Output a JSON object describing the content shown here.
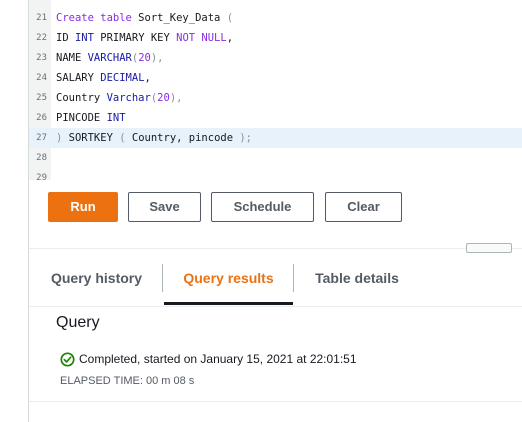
{
  "editor": {
    "lines": [
      {
        "num": "21",
        "tokens": [
          {
            "t": "Create table",
            "c": "kw"
          },
          {
            "t": " Sort_Key_Data ",
            "c": ""
          },
          {
            "t": "(",
            "c": "punct"
          }
        ]
      },
      {
        "num": "22",
        "tokens": [
          {
            "t": "ID ",
            "c": ""
          },
          {
            "t": "INT",
            "c": "kw2"
          },
          {
            "t": " PRIMARY KEY ",
            "c": ""
          },
          {
            "t": "NOT NULL",
            "c": "kw"
          },
          {
            "t": ",",
            "c": ""
          }
        ]
      },
      {
        "num": "23",
        "tokens": [
          {
            "t": "NAME ",
            "c": ""
          },
          {
            "t": "VARCHAR",
            "c": "kw2"
          },
          {
            "t": "(",
            "c": "punct"
          },
          {
            "t": "20",
            "c": "num"
          },
          {
            "t": "),",
            "c": "punct"
          }
        ]
      },
      {
        "num": "24",
        "tokens": [
          {
            "t": "SALARY ",
            "c": ""
          },
          {
            "t": "DECIMAL",
            "c": "kw2"
          },
          {
            "t": ",",
            "c": ""
          }
        ]
      },
      {
        "num": "25",
        "tokens": [
          {
            "t": "Country ",
            "c": ""
          },
          {
            "t": "Varchar",
            "c": "kw2"
          },
          {
            "t": "(",
            "c": "punct"
          },
          {
            "t": "20",
            "c": "num"
          },
          {
            "t": "),",
            "c": "punct"
          }
        ]
      },
      {
        "num": "26",
        "tokens": [
          {
            "t": "PINCODE ",
            "c": ""
          },
          {
            "t": "INT",
            "c": "kw2"
          }
        ]
      },
      {
        "num": "27",
        "active": true,
        "tokens": [
          {
            "t": ")",
            "c": "punct"
          },
          {
            "t": " SORTKEY ",
            "c": ""
          },
          {
            "t": "(",
            "c": "punct"
          },
          {
            "t": " Country, pincode ",
            "c": ""
          },
          {
            "t": ");",
            "c": "punct"
          }
        ]
      },
      {
        "num": "28",
        "tokens": []
      },
      {
        "num": "29",
        "tokens": []
      }
    ]
  },
  "toolbar": {
    "run_label": "Run",
    "save_label": "Save",
    "schedule_label": "Schedule",
    "clear_label": "Clear"
  },
  "tabs": [
    {
      "label": "Query history"
    },
    {
      "label": "Query results"
    },
    {
      "label": "Table details"
    }
  ],
  "result": {
    "title": "Query",
    "status": "Completed, started on January 15, 2021 at 22:01:51",
    "elapsed": "ELAPSED TIME: 00 m 08 s"
  },
  "colors": {
    "accent": "#ec7211",
    "success": "#1d8102"
  },
  "icons": {
    "status": "check-circle-icon"
  }
}
